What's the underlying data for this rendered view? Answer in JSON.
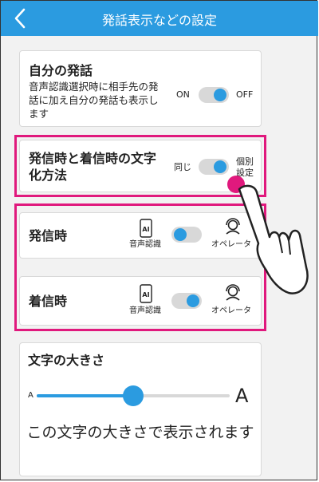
{
  "header": {
    "title": "発話表示などの設定"
  },
  "own_speech": {
    "title": "自分の発話",
    "description": "音声認識選択時に相手先の発話に加え自分の発話も表示します",
    "on_label": "ON",
    "off_label": "OFF",
    "toggle_state": "ON"
  },
  "method": {
    "title": "発信時と着信時の文字化方法",
    "same_label": "同じ",
    "separate_label": "個別設定",
    "toggle_state": "個別設定"
  },
  "outgoing": {
    "title": "発信時",
    "left_label": "音声認識",
    "right_label": "オペレータ",
    "selected": "音声認識",
    "left_icon": "ai-phone-icon",
    "right_icon": "operator-icon"
  },
  "incoming": {
    "title": "着信時",
    "left_label": "音声認識",
    "right_label": "オペレータ",
    "selected": "オペレータ",
    "left_icon": "ai-phone-icon",
    "right_icon": "operator-icon"
  },
  "font_size": {
    "title": "文字の大きさ",
    "min_label": "A",
    "max_label": "A",
    "level": 0.5,
    "preview": "この文字の大きさで表示されます"
  },
  "colors": {
    "accent": "#2b9be0",
    "highlight": "#e0197d"
  }
}
